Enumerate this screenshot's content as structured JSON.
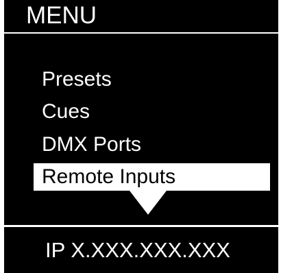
{
  "header": {
    "title": "MENU"
  },
  "menu": {
    "items": [
      {
        "label": "Presets",
        "selected": false
      },
      {
        "label": "Cues",
        "selected": false
      },
      {
        "label": "DMX Ports",
        "selected": false
      },
      {
        "label": "Remote Inputs",
        "selected": true
      }
    ],
    "more_indicator_icon": "triangle-down-icon"
  },
  "footer": {
    "ip_label": "IP X.XXX.XXX.XXX"
  },
  "colors": {
    "background": "#000000",
    "foreground": "#ffffff",
    "selection_background": "#ffffff",
    "selection_text": "#000000"
  }
}
